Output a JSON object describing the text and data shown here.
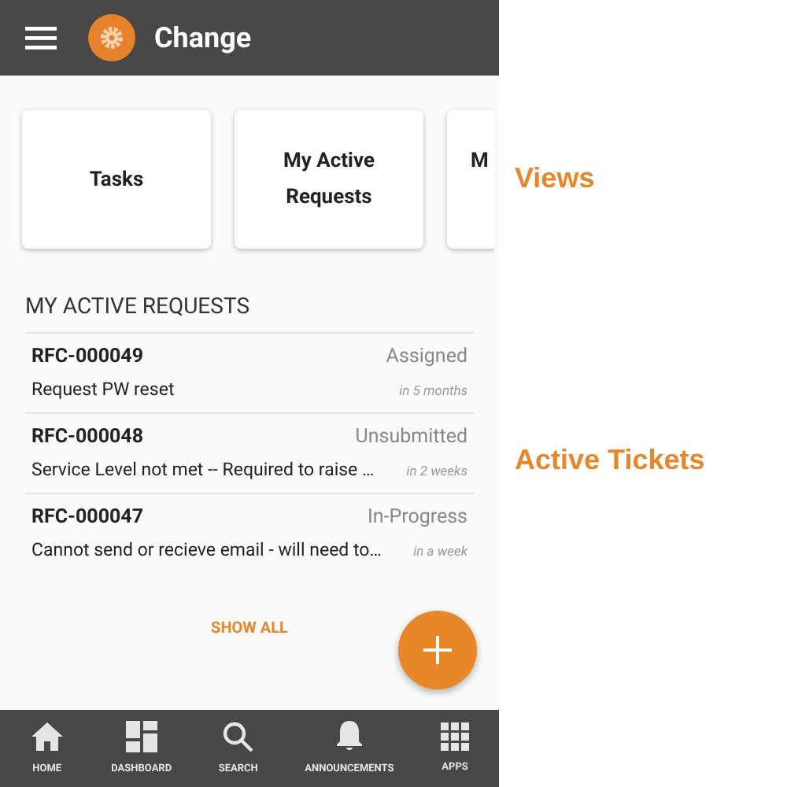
{
  "app_bar": {
    "title": "Change"
  },
  "views": [
    {
      "label": "Tasks"
    },
    {
      "label": "My Active Requests"
    },
    {
      "label": "M"
    }
  ],
  "section_title": "MY ACTIVE REQUESTS",
  "requests": [
    {
      "id": "RFC-000049",
      "status": "Assigned",
      "summary": "Request PW reset",
      "due": "in 5 months"
    },
    {
      "id": "RFC-000048",
      "status": "Unsubmitted",
      "summary": "Service Level not met -- Required to raise …",
      "due": "in 2 weeks"
    },
    {
      "id": "RFC-000047",
      "status": "In-Progress",
      "summary": "Cannot send or recieve email - will need to…",
      "due": "in a week"
    }
  ],
  "show_all": "SHOW ALL",
  "nav": [
    {
      "kind": "home",
      "label": "HOME"
    },
    {
      "kind": "dashboard",
      "label": "DASHBOARD"
    },
    {
      "kind": "search",
      "label": "SEARCH"
    },
    {
      "kind": "bell",
      "label": "ANNOUNCEMENTS"
    },
    {
      "kind": "apps",
      "label": "APPS"
    }
  ],
  "annotations": [
    {
      "label": "Views"
    },
    {
      "label": "Active Tickets"
    }
  ]
}
